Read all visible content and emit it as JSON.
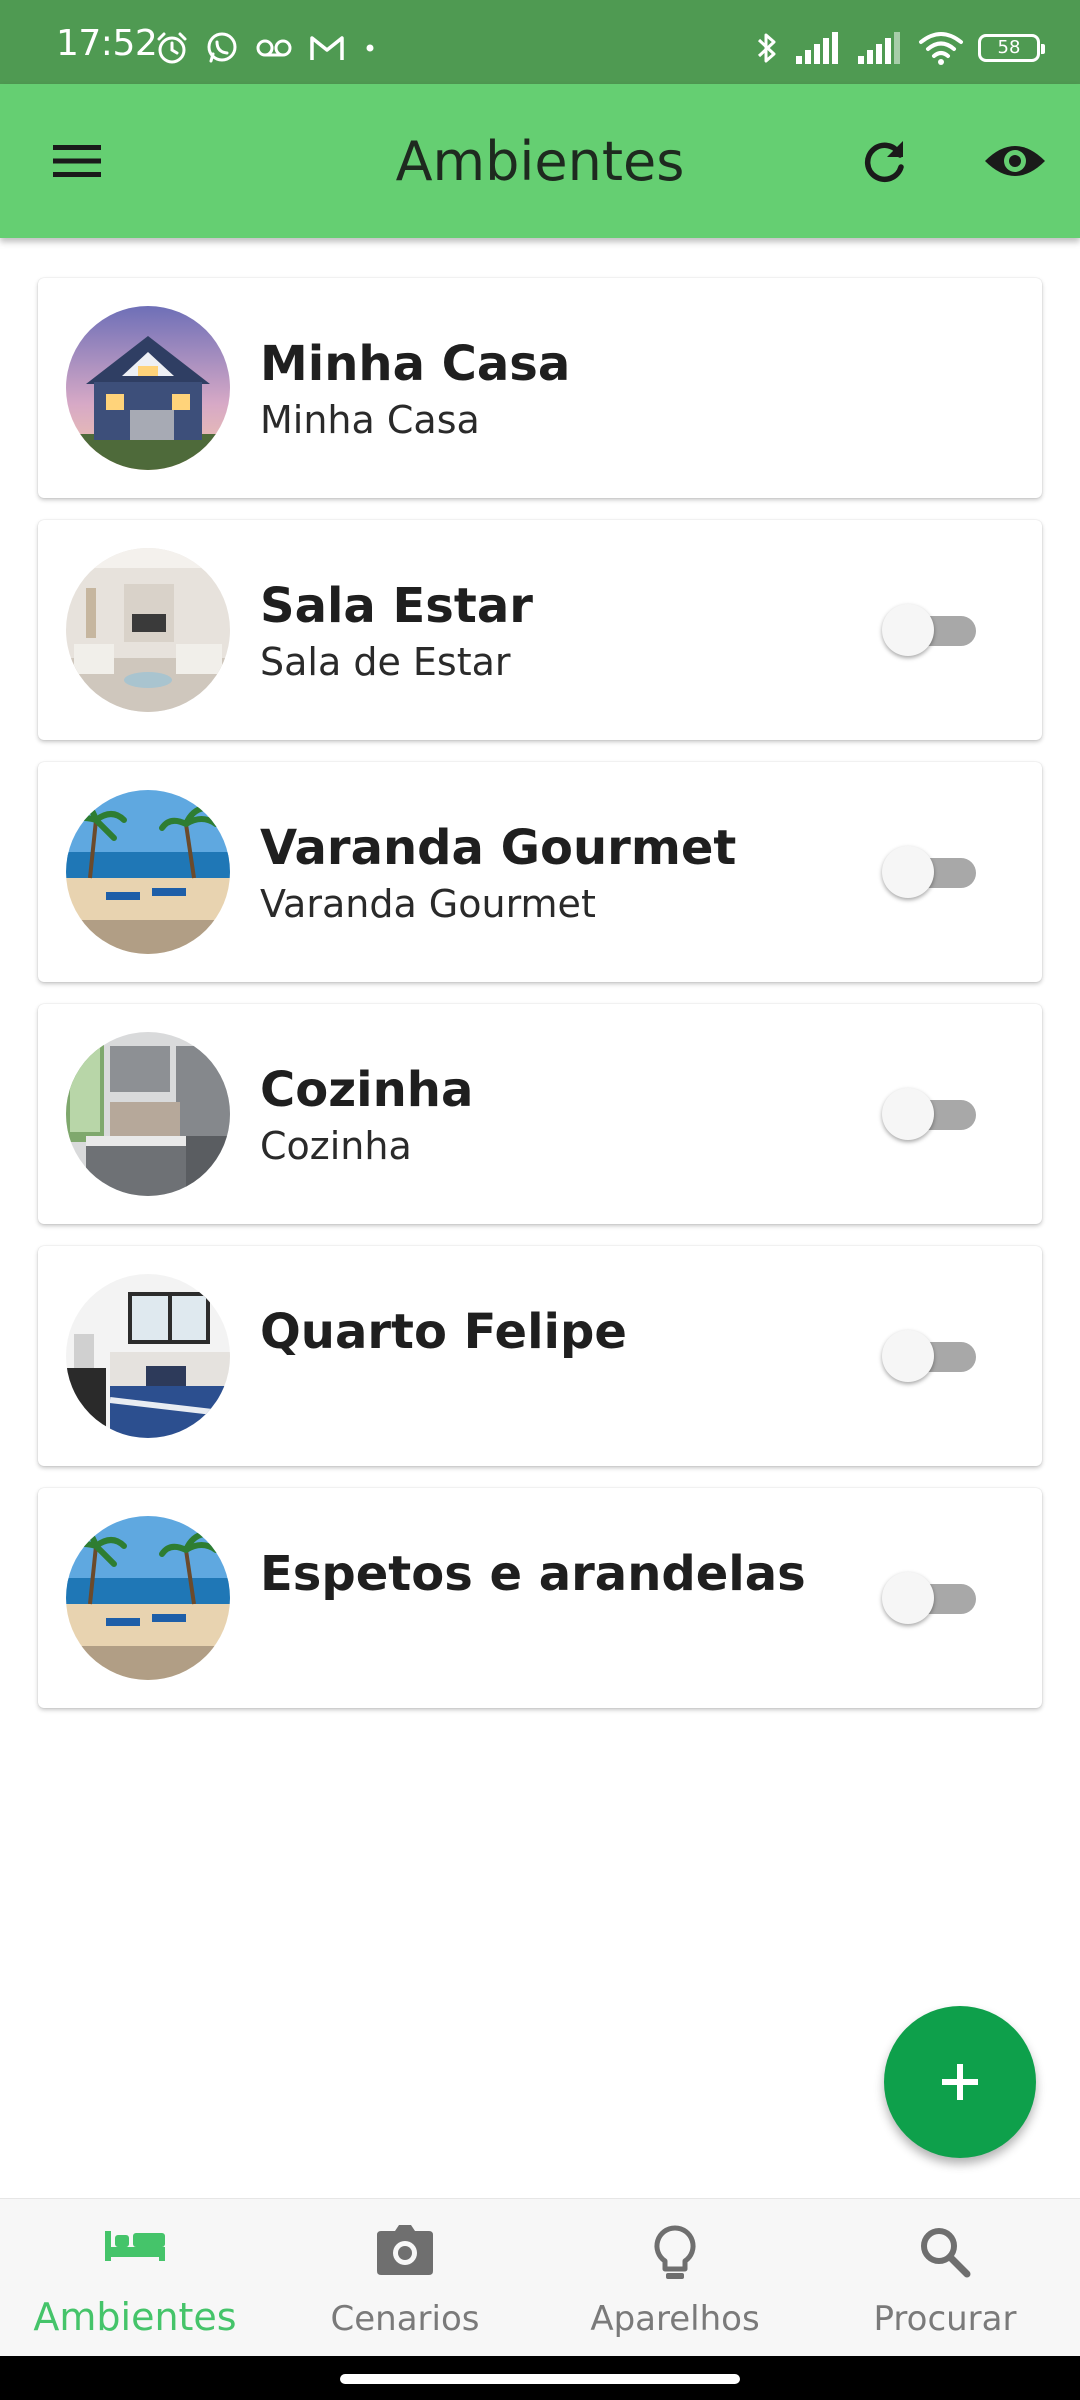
{
  "status_bar": {
    "time": "17:52",
    "battery": "58",
    "left_icons": [
      "alarm-icon",
      "whatsapp-icon",
      "voicemail-icon",
      "gmail-icon",
      "dot-icon"
    ],
    "right_icons": [
      "bluetooth-icon",
      "signal-icon",
      "signal-icon",
      "wifi-icon",
      "battery-icon"
    ]
  },
  "app_bar": {
    "title": "Ambientes",
    "menu_icon": "menu-icon",
    "refresh_icon": "refresh-icon",
    "visibility_icon": "eye-icon"
  },
  "rooms": [
    {
      "title": "Minha Casa",
      "subtitle": "Minha Casa",
      "image": "house-exterior",
      "has_toggle": false
    },
    {
      "title": "Sala Estar",
      "subtitle": "Sala de Estar",
      "image": "living-room",
      "has_toggle": true,
      "toggle_on": false
    },
    {
      "title": "Varanda Gourmet",
      "subtitle": "Varanda Gourmet",
      "image": "beach-deck",
      "has_toggle": true,
      "toggle_on": false
    },
    {
      "title": "Cozinha",
      "subtitle": "Cozinha",
      "image": "kitchen",
      "has_toggle": true,
      "toggle_on": false
    },
    {
      "title": "Quarto Felipe",
      "subtitle": "",
      "image": "bedroom",
      "has_toggle": true,
      "toggle_on": false
    },
    {
      "title": "Espetos e arandelas",
      "subtitle": "",
      "image": "beach-deck",
      "has_toggle": true,
      "toggle_on": false
    }
  ],
  "fab": {
    "icon": "plus-icon"
  },
  "bottom_nav": {
    "items": [
      {
        "label": "Ambientes",
        "icon": "bed-icon",
        "active": true
      },
      {
        "label": "Cenarios",
        "icon": "camera-icon",
        "active": false
      },
      {
        "label": "Aparelhos",
        "icon": "lightbulb-icon",
        "active": false
      },
      {
        "label": "Procurar",
        "icon": "search-icon",
        "active": false
      }
    ]
  },
  "colors": {
    "status_bar": "#4f9a52",
    "app_bar": "#65cf72",
    "fab": "#0ea04b",
    "active_nav": "#45c46a",
    "inactive_nav": "#7a7a7a"
  }
}
